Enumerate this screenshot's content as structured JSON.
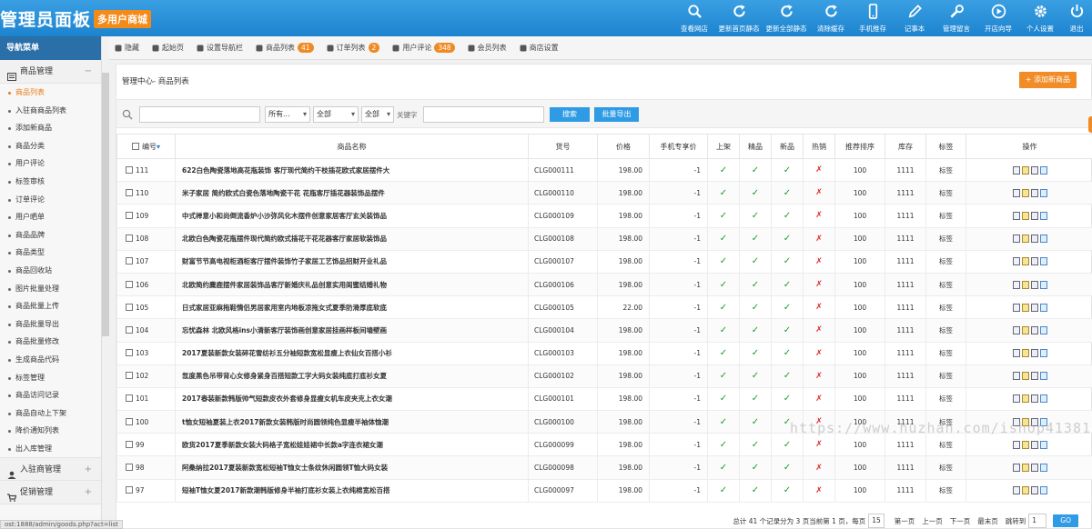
{
  "brand": {
    "title": "管理员面板",
    "tagline": "多用户商城"
  },
  "topnav": [
    {
      "label": "查看网店",
      "icon": "search-icon"
    },
    {
      "label": "更新首页静态",
      "icon": "refresh-icon"
    },
    {
      "label": "更新全部静态",
      "icon": "refresh-icon"
    },
    {
      "label": "清除缓存",
      "icon": "refresh-icon"
    },
    {
      "label": "手机推存",
      "icon": "phone-icon"
    },
    {
      "label": "记事本",
      "icon": "pencil-icon"
    },
    {
      "label": "管理留言",
      "icon": "wrench-icon"
    },
    {
      "label": "开店向导",
      "icon": "play-icon"
    },
    {
      "label": "个人设置",
      "icon": "gear-icon"
    },
    {
      "label": "退出",
      "icon": "power-icon"
    }
  ],
  "sidebar": {
    "title": "导航菜单",
    "group1": {
      "label": "商品管理",
      "toggle": "−"
    },
    "items": [
      "商品列表",
      "入驻商商品列表",
      "添加新商品",
      "商品分类",
      "用户评论",
      "标签审核",
      "订单评论",
      "用户晒单",
      "商品品牌",
      "商品类型",
      "商品回收站",
      "图片批量处理",
      "商品批量上传",
      "商品批量导出",
      "商品批量修改",
      "生成商品代码",
      "标签管理",
      "商品访问记录",
      "商品自动上下架",
      "降价通知列表",
      "出入库管理"
    ],
    "group2": {
      "label": "入驻商管理",
      "toggle": "+"
    },
    "group3": {
      "label": "促销管理",
      "toggle": "+"
    }
  },
  "tabs": [
    {
      "label": "隐藏",
      "badge": ""
    },
    {
      "label": "起始页",
      "badge": ""
    },
    {
      "label": "设置导航栏",
      "badge": ""
    },
    {
      "label": "商品列表",
      "badge": "41"
    },
    {
      "label": "订单列表",
      "badge": "2"
    },
    {
      "label": "用户评论",
      "badge": "348"
    },
    {
      "label": "会员列表",
      "badge": ""
    },
    {
      "label": "商店设置",
      "badge": ""
    }
  ],
  "panel": {
    "breadcrumb": "管理中心- 商品列表",
    "add_button": "+ 添加新商品"
  },
  "filter": {
    "sel_category": "所有...",
    "sel_brand": "全部",
    "sel_status": "全部",
    "keyword_label": "关键字",
    "search_button": "搜索",
    "export_button": "批量导出"
  },
  "table": {
    "headers": [
      "编号",
      "商品名称",
      "货号",
      "价格",
      "手机专享价",
      "上架",
      "精品",
      "新品",
      "热销",
      "推荐排序",
      "库存",
      "标签",
      "操作"
    ],
    "rows": [
      {
        "id": "111",
        "name": "622白色陶瓷落地高花瓶装饰 客厅现代简约干枝插花欧式家居摆件大",
        "sn": "CLG000111",
        "price": "198.00",
        "mobile": "-1",
        "sale": "✓",
        "best": "✓",
        "new": "✓",
        "hot": "✗",
        "sort": "100",
        "stock": "1111",
        "tag": "标签"
      },
      {
        "id": "110",
        "name": "米子家居 简约欧式白瓷色落地陶瓷干花 花瓶客厅插花器装饰品摆件",
        "sn": "CLG000110",
        "price": "198.00",
        "mobile": "-1",
        "sale": "✓",
        "best": "✓",
        "new": "✓",
        "hot": "✗",
        "sort": "100",
        "stock": "1111",
        "tag": "标签"
      },
      {
        "id": "109",
        "name": "中式禅意小和尚倒流香炉小沙弥风化木摆件创意家居客厅玄关装饰品",
        "sn": "CLG000109",
        "price": "198.00",
        "mobile": "-1",
        "sale": "✓",
        "best": "✓",
        "new": "✓",
        "hot": "✗",
        "sort": "100",
        "stock": "1111",
        "tag": "标签"
      },
      {
        "id": "108",
        "name": "北欧白色陶瓷花瓶摆件现代简约欧式插花干花花器客厅家居软装饰品",
        "sn": "CLG000108",
        "price": "198.00",
        "mobile": "-1",
        "sale": "✓",
        "best": "✓",
        "new": "✓",
        "hot": "✗",
        "sort": "100",
        "stock": "1111",
        "tag": "标签"
      },
      {
        "id": "107",
        "name": "财富节节高电视柜酒柜客厅摆件装饰竹子家居工艺饰品招财开业礼品",
        "sn": "CLG000107",
        "price": "198.00",
        "mobile": "-1",
        "sale": "✓",
        "best": "✓",
        "new": "✓",
        "hot": "✗",
        "sort": "100",
        "stock": "1111",
        "tag": "标签"
      },
      {
        "id": "106",
        "name": "北欧简约麋鹿摆件家居装饰品客厅新婚庆礼品创意实用闺蜜结婚礼物",
        "sn": "CLG000106",
        "price": "198.00",
        "mobile": "-1",
        "sale": "✓",
        "best": "✓",
        "new": "✓",
        "hot": "✗",
        "sort": "100",
        "stock": "1111",
        "tag": "标签"
      },
      {
        "id": "105",
        "name": "日式家居亚麻拖鞋情侣男居家用室内地板凉拖女式夏季防滑厚底软底",
        "sn": "CLG000105",
        "price": "22.00",
        "mobile": "-1",
        "sale": "✓",
        "best": "✓",
        "new": "✓",
        "hot": "✗",
        "sort": "100",
        "stock": "1111",
        "tag": "标签"
      },
      {
        "id": "104",
        "name": "忘忧森林 北欧风格ins小清新客厅装饰画创意家居挂画样板间墙壁画",
        "sn": "CLG000104",
        "price": "198.00",
        "mobile": "-1",
        "sale": "✓",
        "best": "✓",
        "new": "✓",
        "hot": "✗",
        "sort": "100",
        "stock": "1111",
        "tag": "标签"
      },
      {
        "id": "103",
        "name": "2017夏装新款女装碎花雪纺衫五分袖短款宽松显瘦上衣仙女百搭小衫",
        "sn": "CLG000103",
        "price": "198.00",
        "mobile": "-1",
        "sale": "✓",
        "best": "✓",
        "new": "✓",
        "hot": "✗",
        "sort": "100",
        "stock": "1111",
        "tag": "标签"
      },
      {
        "id": "102",
        "name": "氙度黑色吊带背心女修身紧身百搭短款工字大码女装纯底打底衫女夏",
        "sn": "CLG000102",
        "price": "198.00",
        "mobile": "-1",
        "sale": "✓",
        "best": "✓",
        "new": "✓",
        "hot": "✗",
        "sort": "100",
        "stock": "1111",
        "tag": "标签"
      },
      {
        "id": "101",
        "name": "2017春装新款韩版帅气短款皮衣外套修身显瘦女机车皮夹克上衣女潮",
        "sn": "CLG000101",
        "price": "198.00",
        "mobile": "-1",
        "sale": "✓",
        "best": "✓",
        "new": "✓",
        "hot": "✗",
        "sort": "100",
        "stock": "1111",
        "tag": "标签"
      },
      {
        "id": "100",
        "name": "t恤女短袖夏装上衣2017新款女装韩版时尚圆领纯色显瘦半袖体恤潮",
        "sn": "CLG000100",
        "price": "198.00",
        "mobile": "-1",
        "sale": "✓",
        "best": "✓",
        "new": "✓",
        "hot": "✗",
        "sort": "100",
        "stock": "1111",
        "tag": "标签"
      },
      {
        "id": "99",
        "name": "欧货2017夏季新款女装大码格子宽松娃娃裙中长款a字连衣裙女潮",
        "sn": "CLG000099",
        "price": "198.00",
        "mobile": "-1",
        "sale": "✓",
        "best": "✓",
        "new": "✓",
        "hot": "✗",
        "sort": "100",
        "stock": "1111",
        "tag": "标签"
      },
      {
        "id": "98",
        "name": "阿桑纳拉2017夏装新款宽松短袖T恤女士条纹休闲圆领T恤大码女装",
        "sn": "CLG000098",
        "price": "198.00",
        "mobile": "-1",
        "sale": "✓",
        "best": "✓",
        "new": "✓",
        "hot": "✗",
        "sort": "100",
        "stock": "1111",
        "tag": "标签"
      },
      {
        "id": "97",
        "name": "短袖T恤女夏2017新款潮韩版修身半袖打底衫女装上衣纯棉宽松百搭",
        "sn": "CLG000097",
        "price": "198.00",
        "mobile": "-1",
        "sale": "✓",
        "best": "✓",
        "new": "✓",
        "hot": "✗",
        "sort": "100",
        "stock": "1111",
        "tag": "标签"
      }
    ]
  },
  "pager": {
    "summary": "总计 41 个记录分为 3 页当前第 1 页，每页",
    "per_page": "15",
    "first": "第一页",
    "prev": "上一页",
    "next": "下一页",
    "last": "最末页",
    "jump_label": "跳转到",
    "jump_value": "1",
    "go": "GO"
  },
  "watermark": "https://www.huzhan.com/ishop41381",
  "statusbar": "ost:1888/admin/goods.php?act=list",
  "colors": {
    "primary": "#1c83cf",
    "accent": "#f28c26",
    "ok": "#1e9a31",
    "no": "#e02a2a"
  }
}
